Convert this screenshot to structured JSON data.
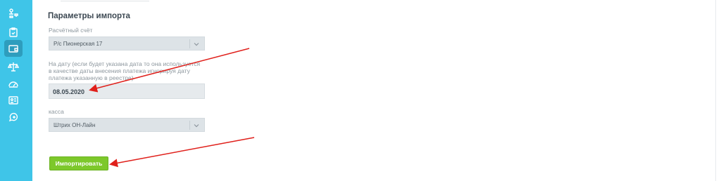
{
  "sidebar": {
    "items": [
      {
        "icon": "people-tree-icon"
      },
      {
        "icon": "clipboard-icon"
      },
      {
        "icon": "wallet-icon",
        "active": true
      },
      {
        "icon": "scale-icon"
      },
      {
        "icon": "dashboard-icon"
      },
      {
        "icon": "id-card-icon"
      },
      {
        "icon": "chat-plus-icon"
      }
    ]
  },
  "import_params": {
    "title": "Параметры импорта",
    "account": {
      "label": "Расчётный счёт",
      "value": "Р/с Пионерская 17"
    },
    "date": {
      "label": "На дату (если будет указана дата то она используется в качестве даты внесения платежа игнорируя дату платежа указанную в реестре)",
      "value": "08.05.2020"
    },
    "cashbox": {
      "label": "касса",
      "value": "Штрих ОН-Лайн"
    },
    "import_button": "Импортировать"
  },
  "colors": {
    "sidebar": "#3fc5e8",
    "sidebar_active": "#2e9dbd",
    "button": "#7dc82b",
    "annotation_arrow": "#e0201b"
  }
}
